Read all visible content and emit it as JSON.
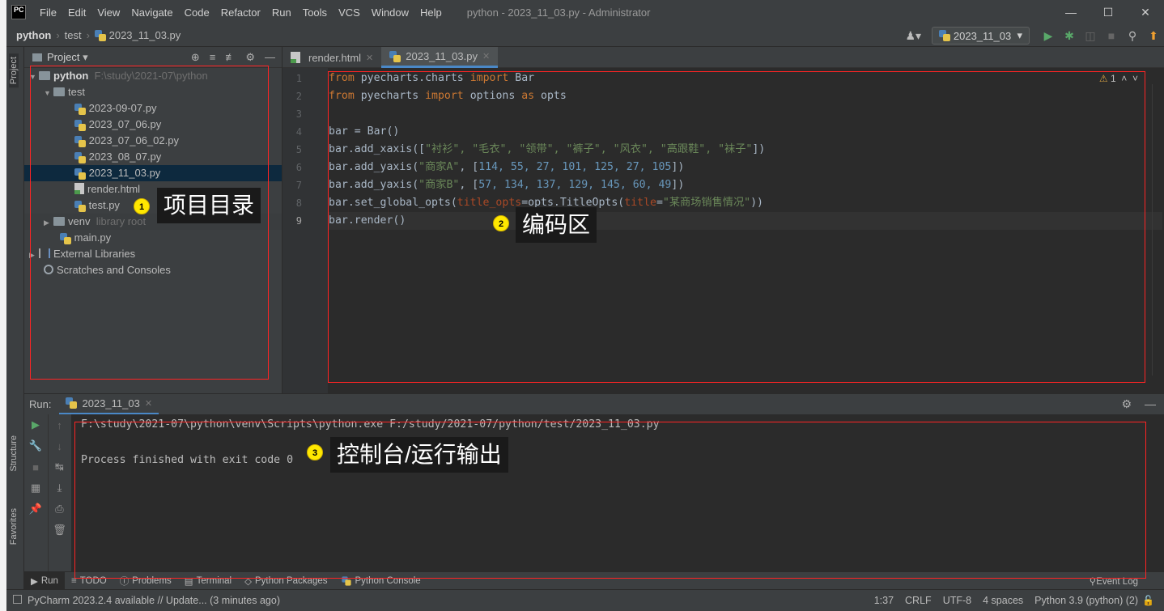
{
  "titlebar": {
    "app_icon": "PC",
    "menu": [
      "File",
      "Edit",
      "View",
      "Navigate",
      "Code",
      "Refactor",
      "Run",
      "Tools",
      "VCS",
      "Window",
      "Help"
    ],
    "window_title": "python - 2023_11_03.py - Administrator"
  },
  "navbar": {
    "breadcrumb": [
      "python",
      "test",
      "2023_11_03.py"
    ],
    "run_config": "2023_11_03"
  },
  "left_strip": {
    "project_tab": "Project",
    "structure_tab": "Structure",
    "favorites_tab": "Favorites"
  },
  "project_panel": {
    "title": "Project",
    "root_name": "python",
    "root_path": "F:\\study\\2021-07\\python",
    "test_folder": "test",
    "files": [
      "2023-09-07.py",
      "2023_07_06.py",
      "2023_07_06_02.py",
      "2023_08_07.py",
      "2023_11_03.py",
      "render.html",
      "test.py"
    ],
    "venv": "venv",
    "venv_note": "library root",
    "main": "main.py",
    "external": "External Libraries",
    "scratches": "Scratches and Consoles"
  },
  "editor": {
    "tabs": [
      "render.html",
      "2023_11_03.py"
    ],
    "active_tab": "2023_11_03.py",
    "line_numbers": [
      "1",
      "2",
      "3",
      "4",
      "5",
      "6",
      "7",
      "8",
      "9"
    ],
    "warning_count": "1",
    "code": {
      "l1": {
        "kw1": "from",
        "mod": " pyecharts.charts ",
        "kw2": "import",
        "rest": " Bar"
      },
      "l2": {
        "kw1": "from",
        "mod": " pyecharts ",
        "kw2": "import",
        "mid": " options ",
        "kw3": "as",
        "rest": " opts"
      },
      "l4": "bar = Bar()",
      "l5": {
        "pre": "bar.add_xaxis([",
        "items": "\"衬衫\", \"毛衣\", \"领带\", \"裤子\", \"风衣\", \"高跟鞋\", \"袜子\"",
        "post": "])"
      },
      "l6": {
        "pre": "bar.add_yaxis(",
        "s": "\"商家A\"",
        "mid": ", [",
        "nums": "114, 55, 27, 101, 125, 27, 105",
        "post": "])"
      },
      "l7": {
        "pre": "bar.add_yaxis(",
        "s": "\"商家B\"",
        "mid": ", [",
        "nums": "57, 134, 137, 129, 145, 60, 49",
        "post": "])"
      },
      "l8": {
        "pre": "bar.set_global_opts(",
        "p1": "title_opts",
        "mid": "=opts.TitleOpts(",
        "p2": "title",
        "eq": "=",
        "s": "\"某商场销售情况\"",
        "post": "))"
      },
      "l9": "bar.render()"
    }
  },
  "run_panel": {
    "label": "Run:",
    "tab": "2023_11_03",
    "cmd": "F:\\study\\2021-07\\python\\venv\\Scripts\\python.exe F:/study/2021-07/python/test/2023_11_03.py",
    "result": "Process finished with exit code 0"
  },
  "bottom_tabs": [
    "Run",
    "TODO",
    "Problems",
    "Terminal",
    "Python Packages",
    "Python Console"
  ],
  "event_log": "Event Log",
  "status": {
    "message": "PyCharm 2023.2.4 available // Update... (3 minutes ago)",
    "position": "1:37",
    "line_sep": "CRLF",
    "encoding": "UTF-8",
    "indent": "4 spaces",
    "interpreter": "Python 3.9 (python) (2)"
  },
  "annotations": {
    "a1": {
      "num": "1",
      "text": "项目目录"
    },
    "a2": {
      "num": "2",
      "text": "编码区"
    },
    "a3": {
      "num": "3",
      "text": "控制台/运行输出"
    }
  },
  "colors": {
    "annotation_box": "#ff2424",
    "badge": "#ffe800",
    "accent": "#4a88c7"
  }
}
